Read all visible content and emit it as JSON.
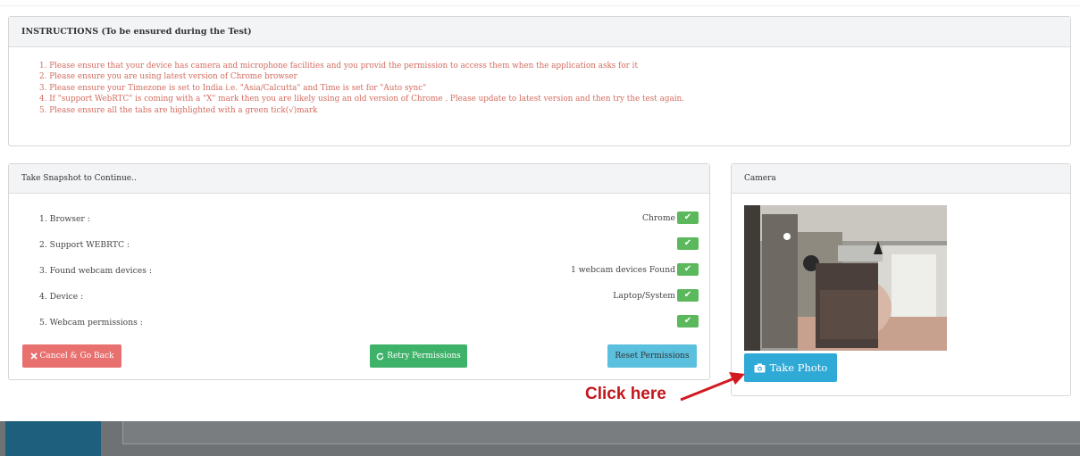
{
  "instructions": {
    "title": "INSTRUCTIONS (To be ensured during the Test)",
    "items": [
      "1. Please ensure that your device has camera and microphone facilities and you provid the permission to access them when the application asks for it",
      "2. Please ensure you are using latest version of Chrome browser",
      "3. Please ensure your Timezone is set to India i.e. \"Asia/Calcutta\" and Time is set for \"Auto sync\"",
      "4. If \"support WebRTC\" is coming with a \"X\" mark then you are likely using an old version of Chrome . Please update to latest version and then try the test again.",
      "5. Please ensure all the tabs are highlighted with a green tick(√)mark"
    ]
  },
  "snapshot": {
    "title": "Take Snapshot to Continue..",
    "checks": [
      {
        "label": "1. Browser :",
        "value": "Chrome"
      },
      {
        "label": "2. Support WEBRTC :",
        "value": ""
      },
      {
        "label": "3. Found webcam devices :",
        "value": "1 webcam devices Found"
      },
      {
        "label": "4. Device :",
        "value": "Laptop/System"
      },
      {
        "label": "5. Webcam permissions :",
        "value": ""
      }
    ],
    "tick_glyph": "✔",
    "buttons": {
      "cancel": "Cancel & Go Back",
      "retry": "Retry Permissions",
      "reset": "Reset Permissions"
    }
  },
  "camera": {
    "title": "Camera",
    "take_photo": "Take Photo"
  },
  "annotation": {
    "text": "Click here"
  },
  "colors": {
    "success": "#5cb85c",
    "danger": "#e8706f",
    "info": "#5bc0de",
    "primary": "#2fa9d6",
    "instruction_text": "#d36b5e",
    "annotation": "#c4161c"
  },
  "icons": {
    "cancel": "times-icon",
    "retry": "refresh-icon",
    "photo": "camera-icon",
    "tick": "check-icon"
  }
}
